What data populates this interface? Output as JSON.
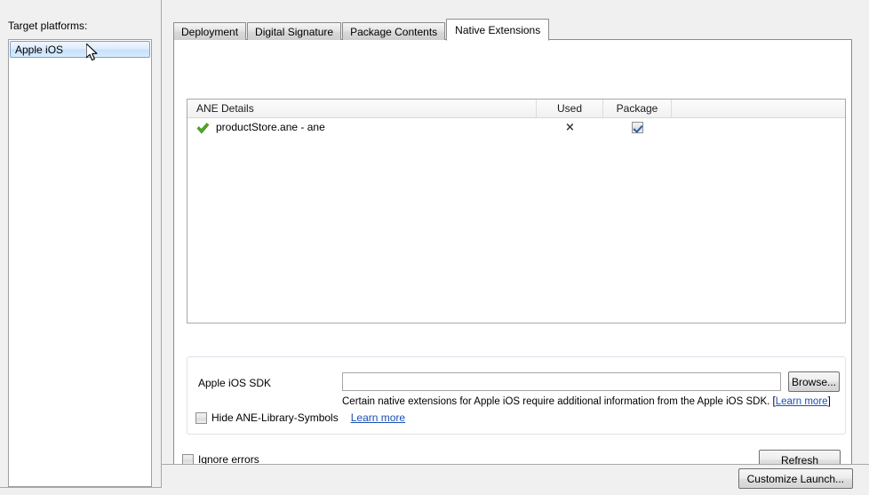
{
  "left_panel": {
    "label": "Target platforms:",
    "platforms": [
      {
        "name": "Apple iOS",
        "selected": true
      }
    ]
  },
  "tabs": [
    {
      "label": "Deployment",
      "active": false
    },
    {
      "label": "Digital Signature",
      "active": false
    },
    {
      "label": "Package Contents",
      "active": false
    },
    {
      "label": "Native Extensions",
      "active": true
    }
  ],
  "ane_table": {
    "columns": [
      "ANE Details",
      "Used",
      "Package",
      ""
    ],
    "rows": [
      {
        "status_icon": "green-check-icon",
        "details": "productStore.ane - ane",
        "used": "×",
        "package_checked": true
      }
    ]
  },
  "sdk_group": {
    "label": "Apple iOS SDK",
    "input_value": "",
    "input_placeholder": "",
    "browse_label": "Browse...",
    "hint_text": "Certain native extensions for Apple iOS require additional information from the  Apple iOS SDK.",
    "hint_link_open_bracket": "[",
    "hint_link": "Learn more",
    "hint_link_close_bracket": "]",
    "hide_ane_label": "Hide ANE-Library-Symbols",
    "hide_ane_checked": false,
    "hide_ane_link": "Learn more"
  },
  "options": {
    "ignore_errors_label": "Ignore errors",
    "ignore_errors_checked": false,
    "refresh_label": "Refresh"
  },
  "bottom_bar": {
    "customize_launch_label": "Customize Launch..."
  },
  "colors": {
    "window_background": "#f0f0f0",
    "panel_background": "#ffffff",
    "selection_border": "#7da2ce",
    "selection_fill": "#c6e0fb",
    "link": "#1a4fb4",
    "check_green": "#4ca828",
    "border": "#a8a8a8"
  }
}
